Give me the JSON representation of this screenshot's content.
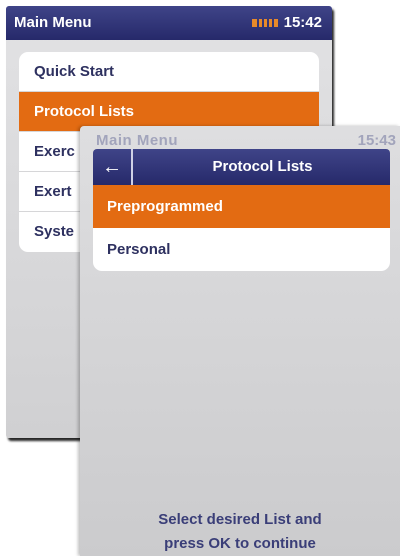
{
  "back_screen": {
    "title": "Main Menu",
    "clock": "15:42",
    "battery_icon": "battery-icon",
    "items": [
      {
        "label": "Quick Start",
        "selected": false
      },
      {
        "label": "Protocol Lists",
        "selected": true
      },
      {
        "label": "Exerc",
        "selected": false
      },
      {
        "label": "Exert",
        "selected": false
      },
      {
        "label": "Syste",
        "selected": false
      }
    ]
  },
  "front_screen": {
    "ghost_title": "Main Menu",
    "ghost_clock": "15:43",
    "nav": {
      "back_icon": "arrow-left-icon",
      "back_glyph": "←",
      "title": "Protocol Lists"
    },
    "items": [
      {
        "label": "Preprogrammed",
        "selected": true
      },
      {
        "label": "Personal",
        "selected": false
      }
    ],
    "hint": {
      "line1": "Select desired List and",
      "line2": "press OK to continue"
    }
  },
  "colors": {
    "header_navy": "#2d3175",
    "accent_orange": "#e36b12",
    "text_navy": "#2e3160",
    "panel_gray": "#d6d6d8"
  }
}
